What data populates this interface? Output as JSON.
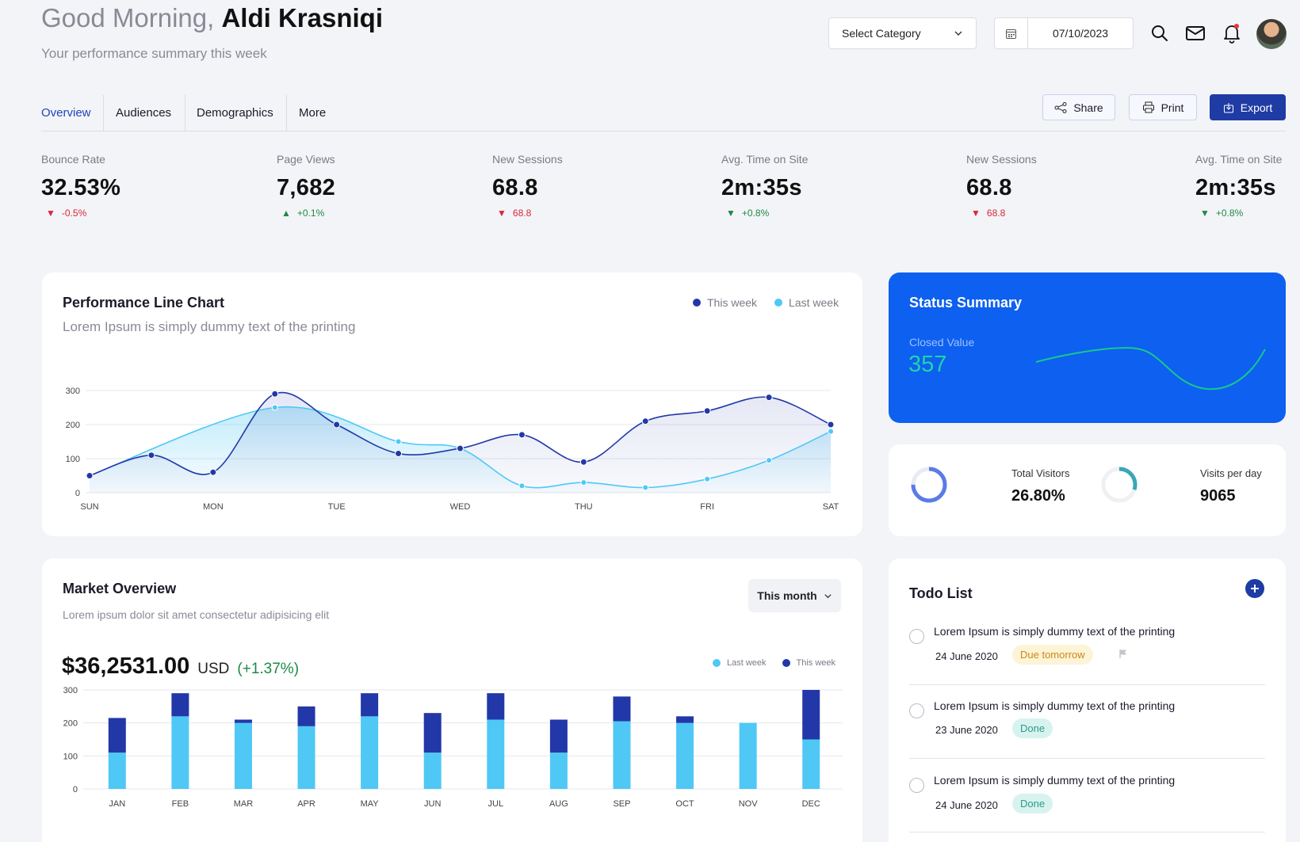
{
  "header": {
    "greeting_prefix": "Good Morning,",
    "user_name": "Aldi Krasniqi",
    "subtitle": "Your performance summary this week",
    "category_select": "Select Category",
    "date": "07/10/2023"
  },
  "tabs": [
    "Overview",
    "Audiences",
    "Demographics",
    "More"
  ],
  "actions": {
    "share": "Share",
    "print": "Print",
    "export": "Export"
  },
  "kpis": [
    {
      "label": "Bounce Rate",
      "value": "32.53%",
      "change": "-0.5%",
      "direction": "down",
      "color": "#d9263c"
    },
    {
      "label": "Page Views",
      "value": "7,682",
      "change": "+0.1%",
      "direction": "up",
      "color": "#1c8a44"
    },
    {
      "label": "New Sessions",
      "value": "68.8",
      "change": "68.8",
      "direction": "down",
      "color": "#d9263c"
    },
    {
      "label": "Avg. Time on Site",
      "value": "2m:35s",
      "change": "+0.8%",
      "direction": "down",
      "color": "#1c8a44"
    },
    {
      "label": "New Sessions",
      "value": "68.8",
      "change": "68.8",
      "direction": "down",
      "color": "#d9263c"
    },
    {
      "label": "Avg. Time on Site",
      "value": "2m:35s",
      "change": "+0.8%",
      "direction": "down",
      "color": "#1c8a44"
    }
  ],
  "performance": {
    "title": "Performance Line Chart",
    "subtitle": "Lorem Ipsum is simply dummy text of the printing",
    "legend": [
      "This week",
      "Last week"
    ]
  },
  "status": {
    "title": "Status Summary",
    "closed_label": "Closed Value",
    "closed_value": "357"
  },
  "visitors": {
    "total_label": "Total Visitors",
    "total_value": "26.80%",
    "visits_label": "Visits per day",
    "visits_value": "9065",
    "total_fraction": 0.75,
    "visits_fraction": 0.3
  },
  "market": {
    "title": "Market Overview",
    "subtitle": "Lorem ipsum dolor sit amet consectetur adipisicing elit",
    "period": "This month",
    "amount": "$36,2531.00",
    "currency": "USD",
    "change": "(+1.37%)",
    "legend": [
      "Last week",
      "This week"
    ]
  },
  "todo": {
    "title": "Todo List",
    "items": [
      {
        "text": "Lorem Ipsum is simply dummy text of the printing",
        "date": "24 June 2020",
        "badge": "Due tomorrow",
        "badge_type": "due",
        "flag": true
      },
      {
        "text": "Lorem Ipsum is simply dummy text of the printing",
        "date": "23 June 2020",
        "badge": "Done",
        "badge_type": "done",
        "flag": false
      },
      {
        "text": "Lorem Ipsum is simply dummy text of the printing",
        "date": "24 June 2020",
        "badge": "Done",
        "badge_type": "done",
        "flag": false
      }
    ]
  },
  "colors": {
    "this_week": "#2238a8",
    "last_week": "#4fc8f5",
    "accent": "#1f3ba4",
    "status_bg": "#0d60f0",
    "status_line": "#16c98a"
  },
  "chart_data": [
    {
      "type": "line",
      "categories": [
        "SUN",
        "MON",
        "TUE",
        "WED",
        "THU",
        "FRI",
        "SAT"
      ],
      "ylim": [
        0,
        300
      ],
      "yticks": [
        0,
        100,
        200,
        300
      ],
      "series": [
        {
          "name": "This week",
          "x": [
            0,
            0.5,
            1,
            1.5,
            2,
            2.5,
            3,
            3.5,
            4,
            4.5,
            5,
            5.5,
            6
          ],
          "values": [
            50,
            110,
            60,
            290,
            200,
            115,
            130,
            170,
            90,
            210,
            240,
            280,
            200
          ]
        },
        {
          "name": "Last week",
          "x": [
            0,
            1.5,
            2.5,
            3,
            3.5,
            4,
            4.5,
            5,
            5.5,
            6
          ],
          "values": [
            50,
            250,
            150,
            130,
            20,
            30,
            15,
            40,
            95,
            180
          ]
        }
      ],
      "legend": "top-right",
      "grid": true
    },
    {
      "type": "bar",
      "stacked": true,
      "categories": [
        "JAN",
        "FEB",
        "MAR",
        "APR",
        "MAY",
        "JUN",
        "JUL",
        "AUG",
        "SEP",
        "OCT",
        "NOV",
        "DEC"
      ],
      "ylim": [
        0,
        300
      ],
      "yticks": [
        0,
        100,
        200,
        300
      ],
      "series": [
        {
          "name": "Last week",
          "values": [
            110,
            220,
            200,
            190,
            220,
            110,
            210,
            110,
            205,
            200,
            200,
            150
          ]
        },
        {
          "name": "This week",
          "values": [
            105,
            70,
            10,
            60,
            70,
            120,
            80,
            100,
            75,
            20,
            0,
            150
          ]
        }
      ],
      "legend": "top-right",
      "grid": true
    }
  ]
}
